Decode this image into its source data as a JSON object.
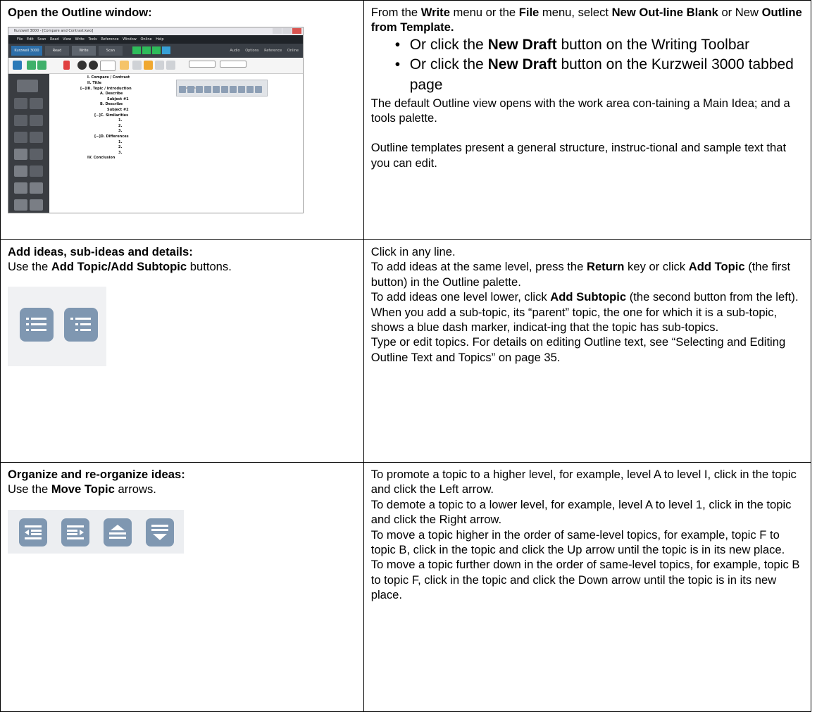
{
  "rows": [
    {
      "left": {
        "heading": "Open the Outline window:",
        "screenshot": {
          "title": "Kurzweil 3000 - [Compare and Contrast.kwo]",
          "menu": [
            "File",
            "Edit",
            "Scan",
            "Read",
            "View",
            "Write",
            "Tools",
            "Reference",
            "Window",
            "Online",
            "Help"
          ],
          "tabs": [
            "Kurzweil 3000",
            "Read",
            "Write",
            "Scan"
          ],
          "right_tabs": [
            "Audio Options",
            "Reference",
            "Online"
          ],
          "palette_title": "Outline Palette",
          "outline": [
            "I. Compare / Contrast",
            "II. Title",
            "[−]III. Topic / Introduction",
            "A. Describe",
            "Subject #1",
            "B. Describe",
            "Subject #2",
            "[−]C. Similarities",
            "1.",
            "2.",
            "3.",
            "[−]D. Differences",
            "1.",
            "2.",
            "3.",
            "IV. Conclusion"
          ]
        }
      },
      "right": {
        "p1_a": "From the ",
        "p1_b": "Write",
        "p1_c": " menu or the ",
        "p1_d": "File",
        "p1_e": " menu, select ",
        "p1_f": "New Out-line Blank",
        "p1_g": " or New ",
        "p1_h": "Outline from Template.",
        "bullet1_a": "Or click the ",
        "bullet1_b": "New Draft",
        "bullet1_c": " button on the Writing Toolbar",
        "bullet2_a": "Or click the ",
        "bullet2_b": "New Draft",
        "bullet2_c": " button on the Kurzweil 3000 tabbed page",
        "p2": "The default Outline view opens with the work area con-taining a Main Idea; and a tools palette.",
        "p3": "Outline templates present a general structure, instruc-tional and sample text that you can edit."
      }
    },
    {
      "left": {
        "heading": "Add ideas, sub-ideas and details:",
        "sub_a": "Use the ",
        "sub_b": "Add Topic/Add Subtopic",
        "sub_c": " buttons.",
        "icons": [
          "add-topic-icon",
          "add-subtopic-icon"
        ]
      },
      "right": {
        "l1": "Click in any line.",
        "l2_a": "To add ideas at the same level, press the ",
        "l2_b": "Return",
        "l2_c": " key or click ",
        "l2_d": "Add Topic",
        "l2_e": " (the first button) in the Outline palette.",
        "l3_a": "To add ideas one level lower, click ",
        "l3_b": "Add Subtopic",
        "l3_c": " (the second button from the left).",
        "l4": "When you add a sub-topic, its “parent” topic, the one for which it is a sub-topic, shows a blue dash marker, indicat-ing that the topic has sub-topics.",
        "l5": "Type or edit topics. For details on editing Outline text, see “Selecting and Editing Outline Text and Topics” on page 35."
      }
    },
    {
      "left": {
        "heading": "Organize and re-organize ideas:",
        "sub_a": "Use the ",
        "sub_b": "Move Topic",
        "sub_c": " arrows.",
        "icons": [
          "move-left-icon",
          "move-right-icon",
          "move-up-icon",
          "move-down-icon"
        ]
      },
      "right": {
        "l1": "To promote a topic to a higher level, for example, level A to level I, click in the topic and click the Left arrow.",
        "l2": "To demote a topic to a lower level, for example, level A to level 1, click in the topic and click the Right arrow.",
        "l3": "To move a topic higher in the order of same-level topics, for example, topic F to topic B, click in the topic and click the Up arrow until the topic is in its new place.",
        "l4": "To move a topic further down in the order of same-level topics, for example, topic B to topic F, click in the topic and click the Down arrow until the topic is in its new place."
      }
    }
  ]
}
